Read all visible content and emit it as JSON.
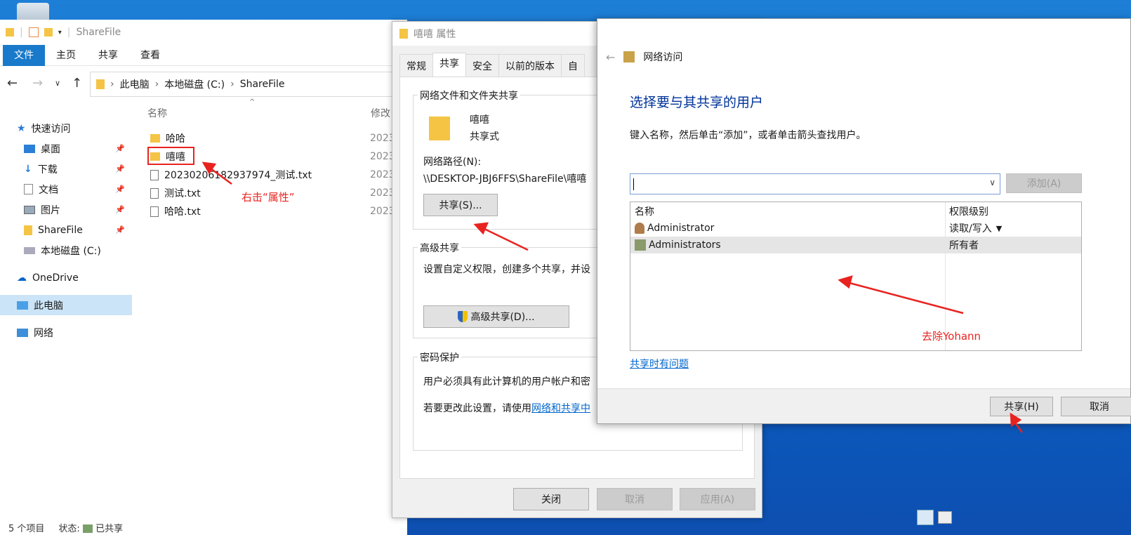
{
  "explorer": {
    "title": "ShareFile",
    "ribbon_tabs": [
      "文件",
      "主页",
      "共享",
      "查看"
    ],
    "breadcrumb": [
      "此电脑",
      "本地磁盘 (C:)",
      "ShareFile"
    ],
    "nav": [
      "快速访问",
      "桌面",
      "下载",
      "文档",
      "图片",
      "ShareFile",
      "本地磁盘 (C:)",
      "OneDrive",
      "此电脑",
      "网络"
    ],
    "col_name": "名称",
    "col_modified": "修改",
    "files": [
      {
        "name": "哈哈",
        "date": "2023"
      },
      {
        "name": "嘻嘻",
        "date": "2023"
      },
      {
        "name": "20230206182937974_测试.txt",
        "date": "2023"
      },
      {
        "name": "测试.txt",
        "date": "2023"
      },
      {
        "name": "哈哈.txt",
        "date": "2023"
      }
    ],
    "status_count": "5 个项目",
    "status_state_label": "状态:",
    "status_state_value": "已共享"
  },
  "properties": {
    "title": "嘻嘻 属性",
    "tabs": [
      "常规",
      "共享",
      "安全",
      "以前的版本",
      "自"
    ],
    "section_network": "网络文件和文件夹共享",
    "folder_name": "嘻嘻",
    "folder_state": "共享式",
    "path_label": "网络路径(N):",
    "path_value": "\\\\DESKTOP-JBJ6FFS\\ShareFile\\嘻嘻",
    "share_button": "共享(S)...",
    "section_advanced": "高级共享",
    "advanced_desc": "设置自定义权限，创建多个共享，并设",
    "advanced_button": "高级共享(D)...",
    "section_password": "密码保护",
    "password_desc": "用户必须具有此计算机的用户帐户和密",
    "password_change": "若要更改此设置，请使用",
    "password_link": "网络和共享中",
    "ok": "关闭",
    "cancel": "取消",
    "apply": "应用(A)"
  },
  "network_access": {
    "title": "网络访问",
    "heading": "选择要与其共享的用户",
    "desc": "键入名称，然后单击“添加”，或者单击箭头查找用户。",
    "add_button": "添加(A)",
    "col_name": "名称",
    "col_perm": "权限级别",
    "rows": [
      {
        "name": "Administrator",
        "perm": "读取/写入"
      },
      {
        "name": "Administrators",
        "perm": "所有者"
      }
    ],
    "trouble_link": "共享时有问题",
    "share_button": "共享(H)",
    "cancel_button": "取消"
  },
  "annotations": {
    "right_click": "右击“属性”",
    "remove": "去除Yohann"
  },
  "colors": {
    "accent": "#1979ca",
    "annotation": "#e8231f",
    "folder": "#f5c445"
  }
}
